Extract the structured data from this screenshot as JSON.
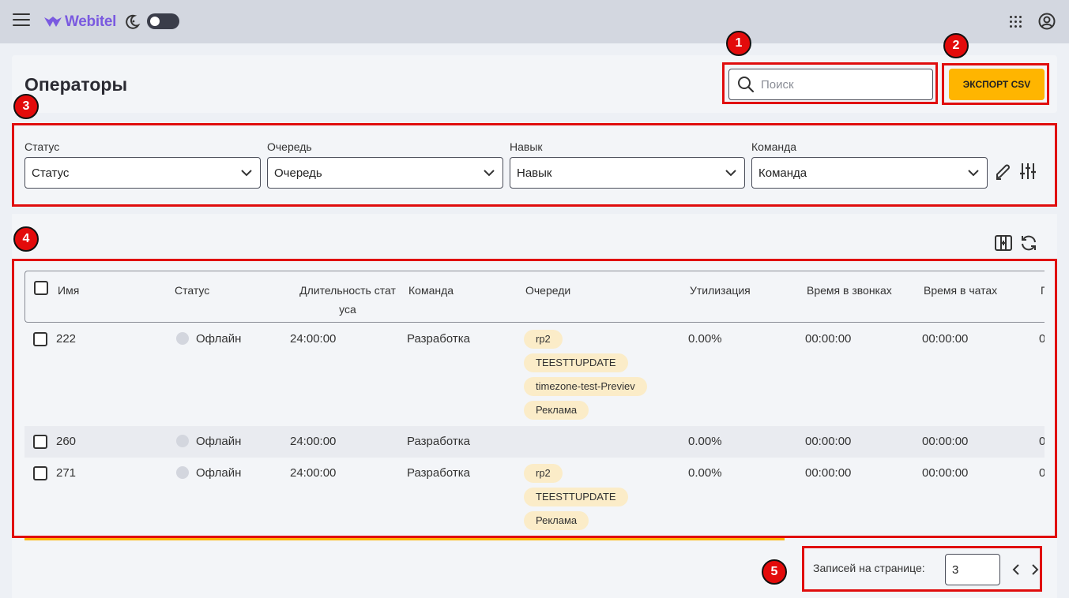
{
  "topbar": {
    "logo_text": "Webitel",
    "icons": [
      "menu-icon",
      "webitel-logo",
      "moon-icon",
      "theme-toggle",
      "apps-grid-icon",
      "account-icon"
    ],
    "theme_toggle": "off"
  },
  "header": {
    "title": "Операторы",
    "search_placeholder": "Поиск",
    "export_label": "ЭКСПОРТ CSV"
  },
  "filters": [
    {
      "label": "Статус",
      "value": "Статус"
    },
    {
      "label": "Очередь",
      "value": "Очередь"
    },
    {
      "label": "Навык",
      "value": "Навык"
    },
    {
      "label": "Команда",
      "value": "Команда"
    }
  ],
  "table": {
    "headers": {
      "name": "Имя",
      "status": "Статус",
      "duration": "Длительность стат уса",
      "team": "Команда",
      "queues": "Очереди",
      "utilization": "Утилизация",
      "call_time": "Время в звонках",
      "chat_time": "Время в чатах",
      "next": "П"
    },
    "rows": [
      {
        "name": "222",
        "status": "Офлайн",
        "duration": "24:00:00",
        "team": "Разработка",
        "queues": [
          "rp2",
          "TEESTTUPDATE",
          "timezone-test-Previev",
          "Реклама"
        ],
        "utilization": "0.00%",
        "call_time": "00:00:00",
        "chat_time": "00:00:00",
        "next": "0"
      },
      {
        "name": "260",
        "status": "Офлайн",
        "duration": "24:00:00",
        "team": "Разработка",
        "queues": [],
        "utilization": "0.00%",
        "call_time": "00:00:00",
        "chat_time": "00:00:00",
        "next": "0"
      },
      {
        "name": "271",
        "status": "Офлайн",
        "duration": "24:00:00",
        "team": "Разработка",
        "queues": [
          "rp2",
          "TEESTTUPDATE",
          "Реклама"
        ],
        "utilization": "0.00%",
        "call_time": "00:00:00",
        "chat_time": "00:00:00",
        "next": "0"
      }
    ]
  },
  "pagination": {
    "label": "Записей на странице:",
    "value": "3"
  },
  "annotations": [
    "1",
    "2",
    "3",
    "4",
    "5"
  ],
  "colors": {
    "accent": "#ffb500",
    "annotation_red": "#e00d0d",
    "chip_bg": "#fbecc8",
    "status_offline": "#d3d6de"
  }
}
